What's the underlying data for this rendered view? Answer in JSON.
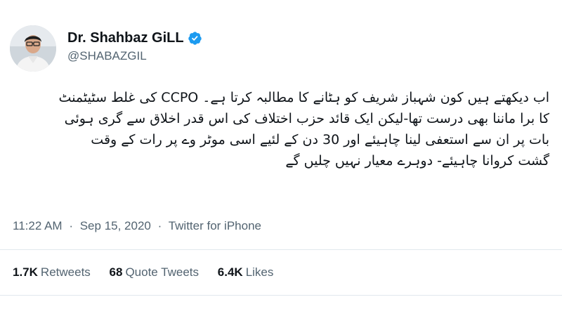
{
  "user": {
    "display_name": "Dr. Shahbaz GiLL",
    "handle": "@SHABAZGIL",
    "avatar_icon": "profile-photo-avatar",
    "verified_icon": "verified-badge-icon",
    "verified_color": "#1d9bf0"
  },
  "tweet": {
    "text_lines": [
      "اب دیکھتے ہیں کون شہباز شریف کو ہٹانے کا مطالبہ کرتا ہے۔ CCPO کی غلط سٹیٹمنٹ",
      "کا برا ماننا بھی درست تھا-لیکن ایک قائد حزب اختلاف کی اس قدر اخلاق سے گری ہوئی",
      "بات پر ان سے استعفی لینا چاہیئے اور 30 دن کے لئیے اسی موٹر وے پر رات کے وقت",
      "گشت کروانا چاہیئے- دوہرے معیار نہیں چلیں گے"
    ],
    "time": "11:22 AM",
    "separator": "·",
    "date": "Sep 15, 2020",
    "source": "Twitter for iPhone"
  },
  "stats": {
    "retweets_count": "1.7K",
    "retweets_label": "Retweets",
    "quotes_count": "68",
    "quotes_label": "Quote Tweets",
    "likes_count": "6.4K",
    "likes_label": "Likes"
  }
}
